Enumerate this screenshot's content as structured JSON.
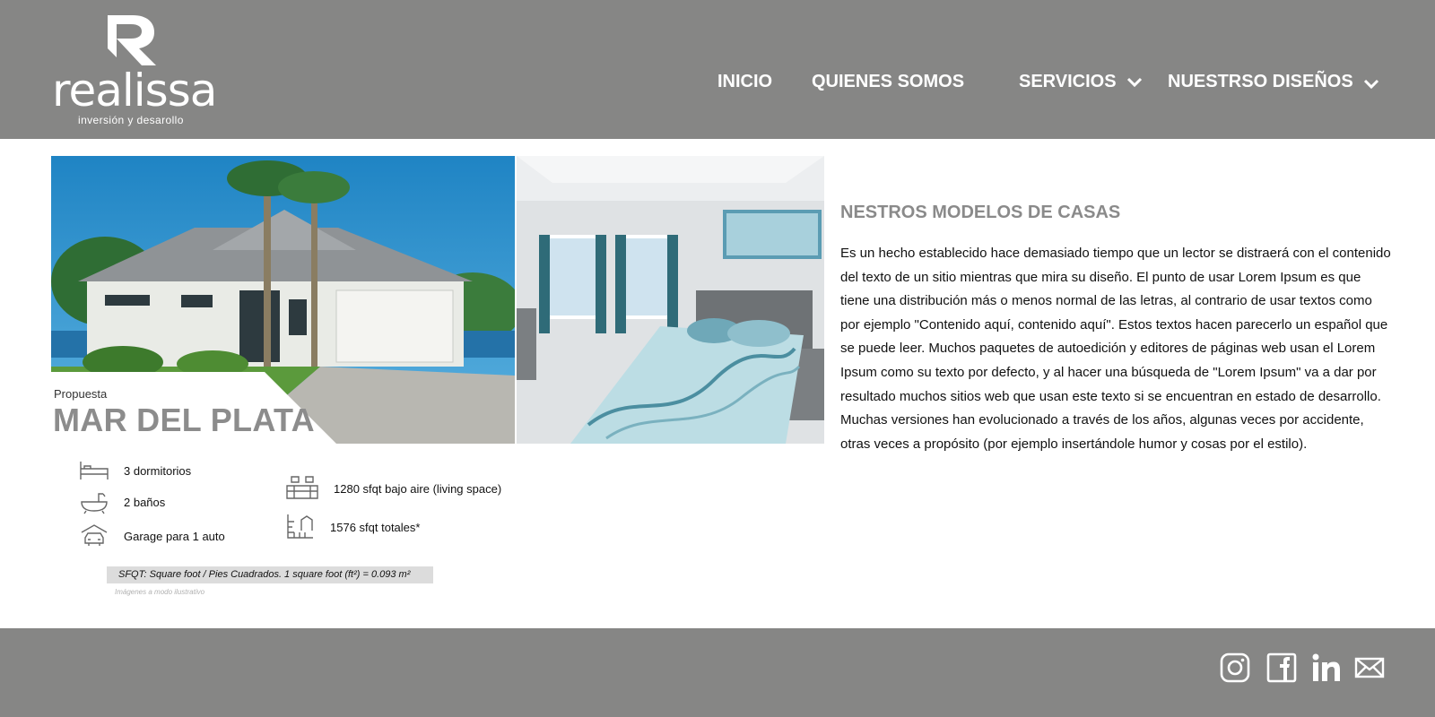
{
  "brand": {
    "name": "realissa",
    "tagline": "inversión y desarollo"
  },
  "nav": {
    "items": [
      {
        "label": "INICIO"
      },
      {
        "label": "QUIENES SOMOS"
      },
      {
        "label": "SERVICIOS",
        "icon": "chevron-down-icon"
      },
      {
        "label": "NUESTRSO DISEÑOS",
        "icon": "chevron-down-icon"
      }
    ]
  },
  "property": {
    "label": "Propuesta",
    "name": "MAR DEL PLATA",
    "features": [
      {
        "icon": "bed-icon",
        "text": "3 dormitorios"
      },
      {
        "icon": "bathtub-icon",
        "text": "2 baños"
      },
      {
        "icon": "car-icon",
        "text": "Garage para 1 auto"
      },
      {
        "icon": "sofa-icon",
        "text": "1280 sfqt bajo aire (living space)"
      },
      {
        "icon": "floorplan-icon",
        "text": "1576 sfqt totales*"
      }
    ],
    "note": "SFQT: Square foot / Pies Cuadrados.  1 square foot (ft²) = 0.093 m²",
    "disclaimer": "Imágenes a modo ilustrativo"
  },
  "section": {
    "title": "NESTROS MODELOS DE CASAS",
    "body": "Es  un hecho establecido  hace demasiado tiempo que un lector se distraerá  con  el contenido  del texto de un sitio mientras que mira su diseño. El punto de usar Lorem Ipsum es que tiene una distribución más o  menos normal  de las letras, al contrario de usar textos como por  ejemplo  \"Contenido aquí,  contenido aquí\". Estos textos hacen parecerlo  un español que se puede leer. Muchos paquetes de  autoedición  y  editores de  páginas web  usan el Lorem Ipsum como  su  texto  por  defecto,  y  al  hacer una búsqueda de \"Lorem Ipsum\"  va  a  dar  por resultado  muchos  sitios web que usan este texto  si se encuentran en estado de  desarrollo. Muchas versiones han evolucionado a través de los años, algunas veces por accidente,  otras   veces a  propósito  (por ejemplo insertándole humor y cosas por el estilo)."
  },
  "footer": {
    "social": [
      "instagram-icon",
      "facebook-icon",
      "linkedin-icon",
      "mail-icon"
    ]
  },
  "colors": {
    "header_bg": "#868685",
    "footer_bg": "#868685",
    "title_gray": "#8a8a8a"
  }
}
